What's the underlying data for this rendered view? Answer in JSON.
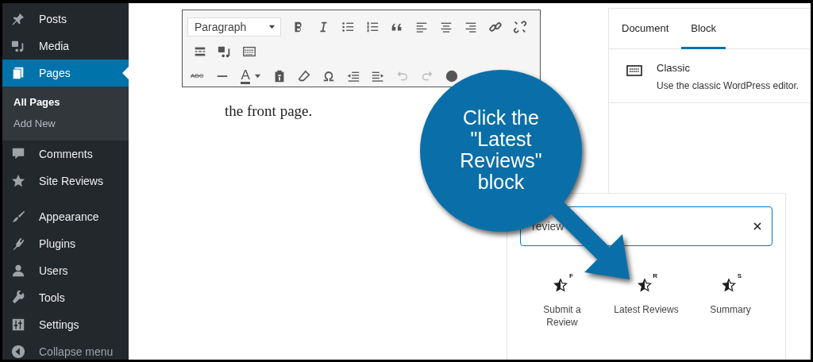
{
  "sidebar": {
    "items": [
      {
        "label": "Posts",
        "selected": false
      },
      {
        "label": "Media",
        "selected": false
      },
      {
        "label": "Pages",
        "selected": true,
        "children": [
          {
            "label": "All Pages",
            "selected": true
          },
          {
            "label": "Add New",
            "selected": false
          }
        ]
      },
      {
        "label": "Comments",
        "selected": false
      },
      {
        "label": "Site Reviews",
        "selected": false
      },
      {
        "label": "Appearance",
        "selected": false
      },
      {
        "label": "Plugins",
        "selected": false
      },
      {
        "label": "Users",
        "selected": false
      },
      {
        "label": "Tools",
        "selected": false
      },
      {
        "label": "Settings",
        "selected": false
      }
    ],
    "collapse": "Collapse menu"
  },
  "toolbar": {
    "format": "Paragraph",
    "strike_label": "ABC",
    "color_label": "A"
  },
  "editor": {
    "text": "the front page."
  },
  "panel": {
    "tabs": [
      {
        "label": "Document",
        "selected": false
      },
      {
        "label": "Block",
        "selected": true
      }
    ],
    "block": {
      "title": "Classic",
      "description": "Use the classic WordPress editor."
    }
  },
  "inserter": {
    "search": {
      "value": "review"
    },
    "items": [
      {
        "label": "Submit a Review",
        "badge": "F"
      },
      {
        "label": "Latest Reviews",
        "badge": "R"
      },
      {
        "label": "Summary",
        "badge": "S"
      }
    ]
  },
  "callout": {
    "text": "Click the\n\"Latest\nReviews\"\nblock"
  }
}
